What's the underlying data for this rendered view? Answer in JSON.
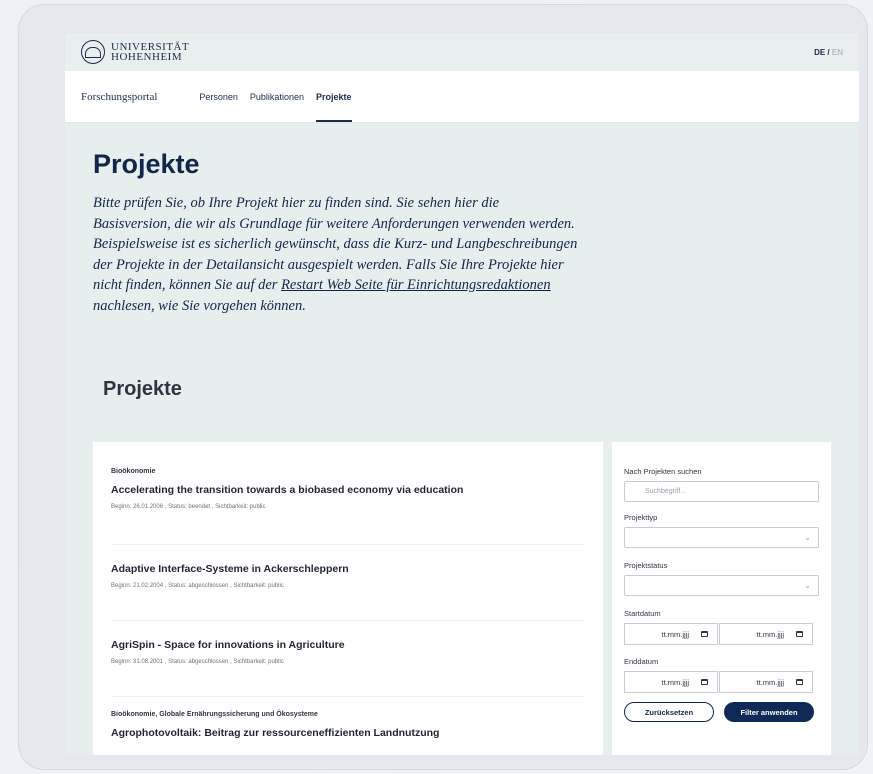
{
  "header": {
    "logo_line1": "UNIVERSITÄT",
    "logo_line2": "HOHENHEIM",
    "lang_active": "DE",
    "lang_sep": " / ",
    "lang_inactive": "EN"
  },
  "nav": {
    "brand": "Forschungsportal",
    "items": [
      {
        "label": "Personen"
      },
      {
        "label": "Publikationen"
      },
      {
        "label": "Projekte"
      }
    ]
  },
  "hero": {
    "title": "Projekte",
    "intro_before": "Bitte prüfen Sie, ob Ihre Projekt hier zu finden sind. Sie sehen hier die Basisversion, die wir als Grundlage für weitere Anforderungen verwenden werden. Beispielsweise ist es sicherlich gewünscht, dass die Kurz- und Langbeschreibungen der Projekte in der Detailansicht ausgespielt werden. Falls Sie Ihre Projekte hier nicht finden, können Sie auf der ",
    "intro_link": "Restart Web Seite für Einrichtungsredaktionen",
    "intro_after": " nachlesen, wie Sie vorgehen können."
  },
  "list": {
    "section_title": "Projekte",
    "projects": [
      {
        "category": "Bioökonomie",
        "title": "Accelerating the transition towards a biobased economy via education",
        "begin": "Beginn: 26.01.2006",
        "status": "Status: beendet",
        "visibility": "Sichtbarkeit: public"
      },
      {
        "category": "",
        "title": "Adaptive Interface-Systeme in Ackerschleppern",
        "begin": "Beginn: 21.02.2004",
        "status": "Status: abgeschlossen",
        "visibility": "Sichtbarkeit: public"
      },
      {
        "category": "",
        "title": "AgriSpin - Space for innovations in Agriculture",
        "begin": "Beginn: 31.08.2001",
        "status": "Status: abgeschlossen",
        "visibility": "Sichtbarkeit: public"
      },
      {
        "category": "Bioökonomie, Globale Ernährungssicherung und Ökosysteme",
        "title": "Agrophotovoltaik: Beitrag zur ressourceneffizienten Landnutzung",
        "begin": "",
        "status": "",
        "visibility": ""
      }
    ],
    "meta_sep": ","
  },
  "filter": {
    "search_label": "Nach Projekten suchen",
    "search_placeholder": "Suchbegriff...",
    "type_label": "Projekttyp",
    "status_label": "Projektstatus",
    "start_label": "Startdatum",
    "end_label": "Enddatum",
    "date_placeholder": "tt.mm.jjjj",
    "reset_label": "Zurücksetzen",
    "apply_label": "Filter anwenden"
  }
}
